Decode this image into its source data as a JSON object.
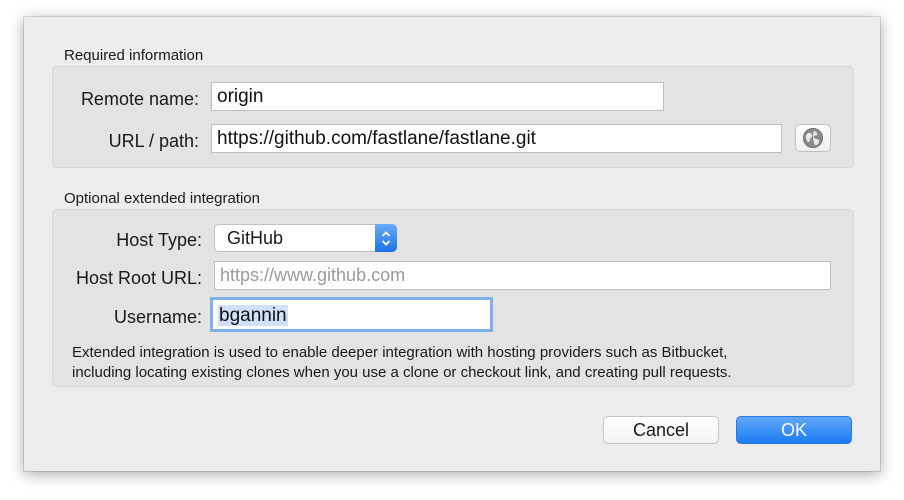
{
  "required": {
    "title": "Required information",
    "remote_name_label": "Remote name:",
    "remote_name_value": "origin",
    "url_label": "URL / path:",
    "url_value": "https://github.com/fastlane/fastlane.git",
    "browse_icon": "globe-icon"
  },
  "optional": {
    "title": "Optional extended integration",
    "host_type_label": "Host Type:",
    "host_type_value": "GitHub",
    "host_root_label": "Host Root URL:",
    "host_root_placeholder": "https://www.github.com",
    "username_label": "Username:",
    "username_value": "bgannin",
    "help_line_1": "Extended integration is used to enable deeper integration with hosting providers such as Bitbucket,",
    "help_line_2": "including locating existing clones when you use a clone or checkout link, and creating pull requests."
  },
  "buttons": {
    "cancel_label": "Cancel",
    "ok_label": "OK"
  },
  "colors": {
    "accent": "#1b7bf2",
    "focus_ring": "#7fb0ec",
    "selection": "#cfe0fb"
  }
}
